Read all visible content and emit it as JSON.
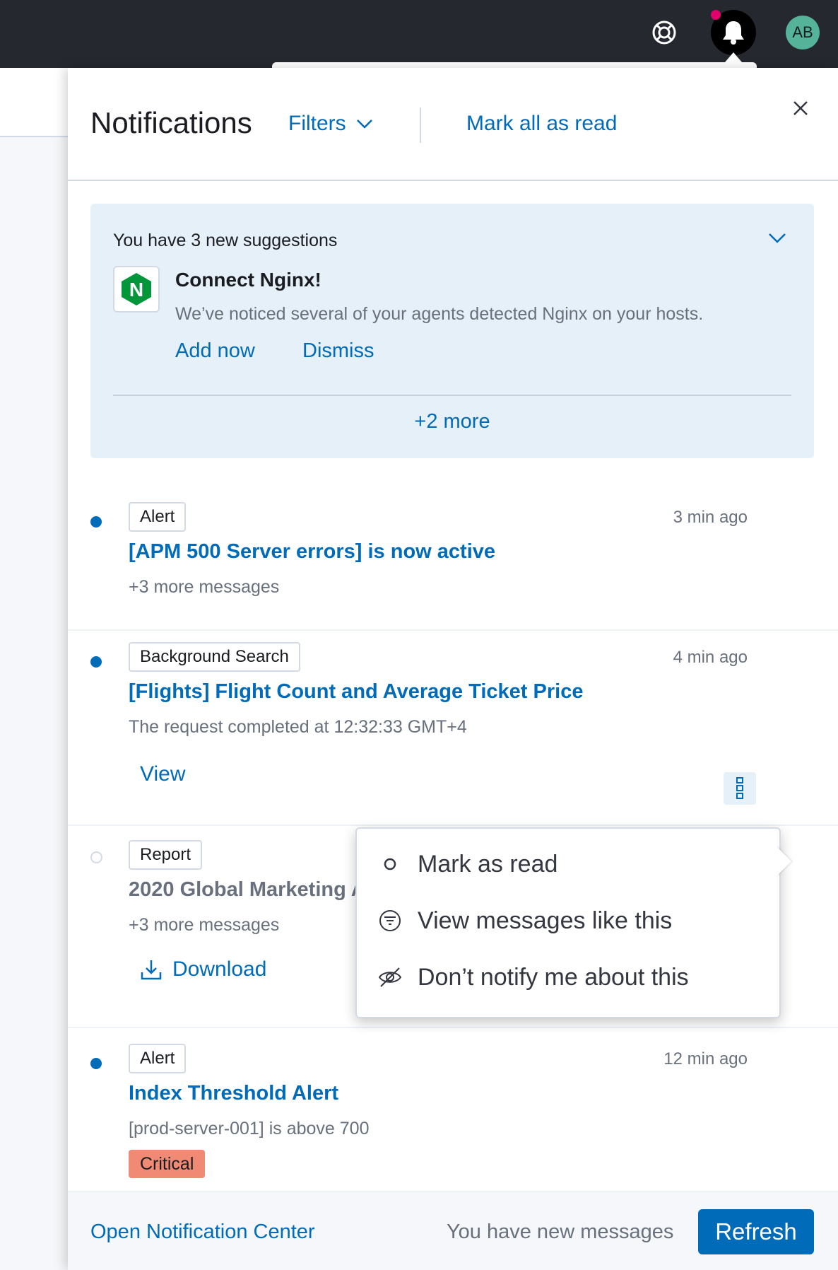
{
  "topbar": {
    "avatar_initials": "AB",
    "help_icon": "lifebuoy-icon",
    "bell_icon": "bell-icon",
    "unread_indicator_color": "#e4006c"
  },
  "flyout": {
    "title": "Notifications",
    "filters_label": "Filters",
    "mark_all_label": "Mark all as read"
  },
  "suggestions": {
    "count_text": "You have 3 new suggestions",
    "item": {
      "logo_letter": "N",
      "title": "Connect Nginx!",
      "description": "We’ve noticed several of your agents detected Nginx on your hosts.",
      "add_label": "Add now",
      "dismiss_label": "Dismiss"
    },
    "more_label": "+2 more"
  },
  "notifications": [
    {
      "badge": "Alert",
      "time": "3 min ago",
      "title": "[APM 500 Server errors] is now active",
      "sub": "+3 more messages",
      "unread": true
    },
    {
      "badge": "Background Search",
      "time": "4 min ago",
      "title": "[Flights] Flight Count and Average Ticket Price",
      "sub": "The request completed at 12:32:33 GMT+4",
      "link": "View",
      "unread": true
    },
    {
      "badge": "Report",
      "title": "2020 Global Marketing A",
      "sub": "+3 more messages",
      "link": "Download",
      "unread": false
    },
    {
      "badge": "Alert",
      "time": "12 min ago",
      "title": "Index Threshold Alert",
      "sub": "[prod-server-001] is above 700",
      "severity": "Critical",
      "unread": true
    }
  ],
  "context_menu": {
    "items": [
      {
        "label": "Mark as read",
        "icon": "empty-circle-icon"
      },
      {
        "label": "View messages like this",
        "icon": "filter-icon"
      },
      {
        "label": "Don’t notify me about this",
        "icon": "eye-off-icon"
      }
    ]
  },
  "footer": {
    "open_center_label": "Open Notification Center",
    "new_messages_text": "You have new messages",
    "refresh_label": "Refresh"
  },
  "colors": {
    "link": "#006bb8",
    "critical": "#f08a75",
    "topbar": "#25282f",
    "suggestion_bg": "#e6f0f8"
  }
}
